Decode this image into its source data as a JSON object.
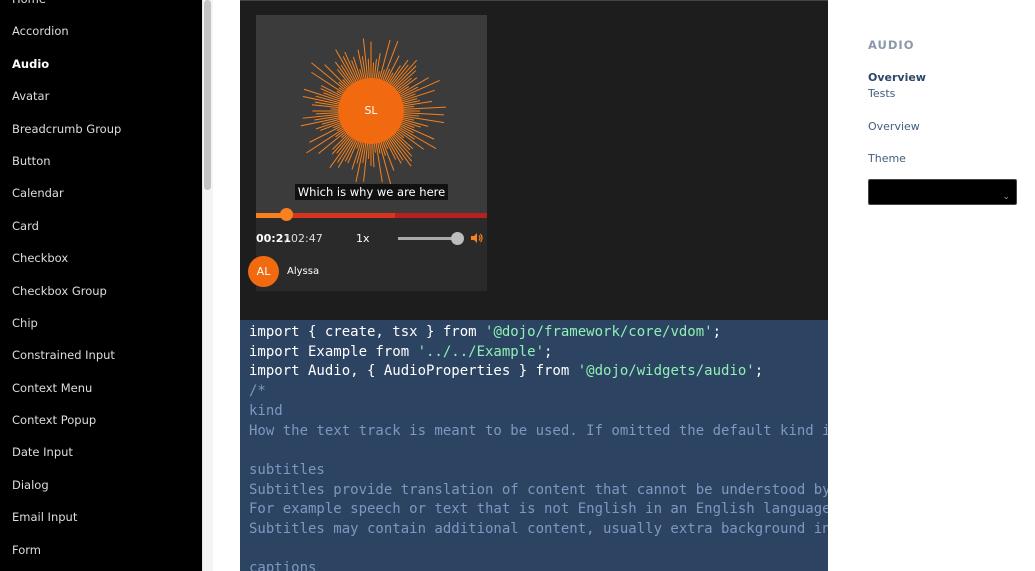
{
  "sidebar": {
    "items": [
      {
        "label": "Home"
      },
      {
        "label": "Accordion"
      },
      {
        "label": "Audio",
        "active": true
      },
      {
        "label": "Avatar"
      },
      {
        "label": "Breadcrumb Group"
      },
      {
        "label": "Button"
      },
      {
        "label": "Calendar"
      },
      {
        "label": "Card"
      },
      {
        "label": "Checkbox"
      },
      {
        "label": "Checkbox Group"
      },
      {
        "label": "Chip"
      },
      {
        "label": "Constrained Input"
      },
      {
        "label": "Context Menu"
      },
      {
        "label": "Context Popup"
      },
      {
        "label": "Date Input"
      },
      {
        "label": "Dialog"
      },
      {
        "label": "Email Input"
      },
      {
        "label": "Form"
      }
    ]
  },
  "player": {
    "initials": "SL",
    "caption": "Which is why we are here",
    "current_time": "00:21",
    "time_separator": "/",
    "total_time": "02:47",
    "rate": "1x",
    "played_fraction": 0.13,
    "buffered_fraction": 0.6,
    "volume_fraction": 1.0,
    "speaker_initials": "AL",
    "speaker_name": "Alyssa",
    "accent_color": "#f7811e",
    "progress_color": "#d9341f"
  },
  "code": {
    "lines": [
      [
        [
          "kw",
          "import { create, tsx } from "
        ],
        [
          "str",
          "'@dojo/framework/core/vdom'"
        ],
        [
          "kw",
          ";"
        ]
      ],
      [
        [
          "kw",
          "import Example from "
        ],
        [
          "str",
          "'../../Example'"
        ],
        [
          "kw",
          ";"
        ]
      ],
      [
        [
          "kw",
          "import Audio, { AudioProperties } from "
        ],
        [
          "str",
          "'@dojo/widgets/audio'"
        ],
        [
          "kw",
          ";"
        ]
      ],
      [
        [
          "cm",
          "/*"
        ]
      ],
      [
        [
          "cm",
          "kind"
        ]
      ],
      [
        [
          "cm",
          "How the text track is meant to be used. If omitted the default kind is sub"
        ]
      ],
      [
        [
          "cm",
          ""
        ]
      ],
      [
        [
          "cm",
          "subtitles"
        ]
      ],
      [
        [
          "cm",
          "Subtitles provide translation of content that cannot be understood by the"
        ]
      ],
      [
        [
          "cm",
          "For example speech or text that is not English in an English language film."
        ]
      ],
      [
        [
          "cm",
          "Subtitles may contain additional content, usually extra background informa"
        ]
      ],
      [
        [
          "cm",
          ""
        ]
      ],
      [
        [
          "cm",
          "captions"
        ]
      ]
    ]
  },
  "right_panel": {
    "title": "AUDIO",
    "links": [
      {
        "label": "Overview",
        "active": true
      },
      {
        "label": "Tests"
      },
      {
        "label": "Overview"
      },
      {
        "label": "Theme"
      }
    ],
    "theme_value": ""
  }
}
